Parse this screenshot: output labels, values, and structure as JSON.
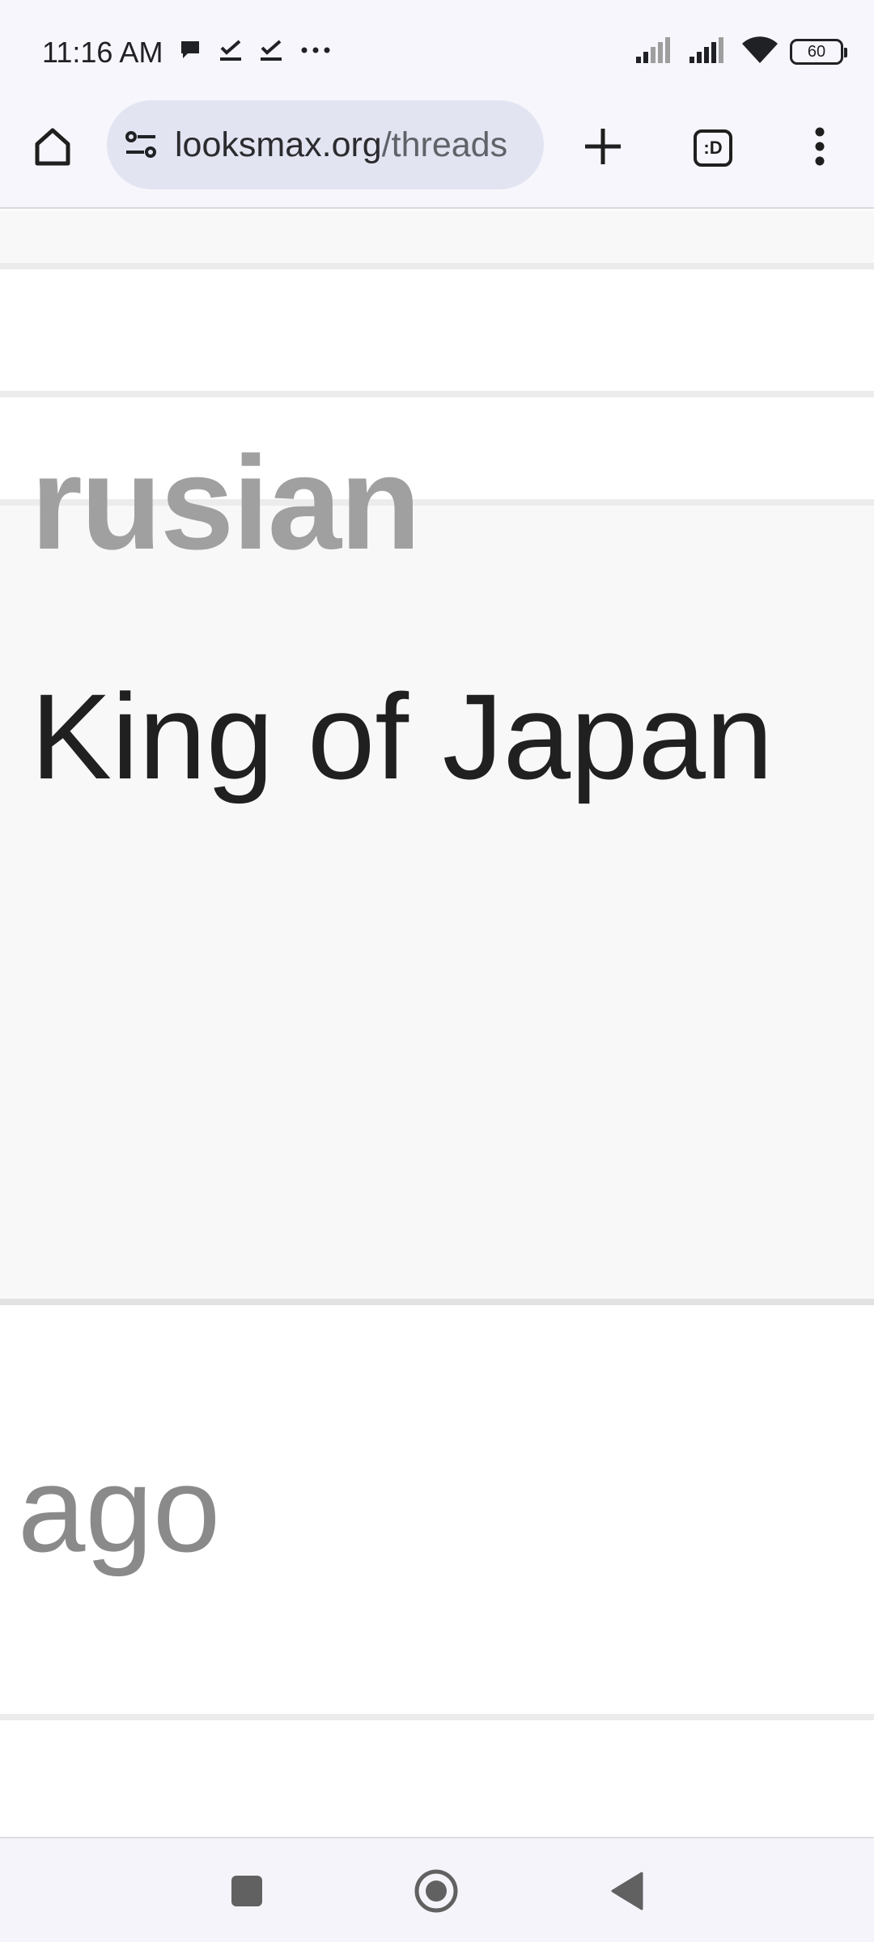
{
  "status_bar": {
    "time": "11:16 AM",
    "left_icons": [
      "chat-bubble-icon",
      "download-done-icon",
      "download-done-icon",
      "more-dots-icon"
    ],
    "right_icons": [
      "signal-icon",
      "signal-icon",
      "wifi-icon"
    ],
    "battery_level": "60"
  },
  "toolbar": {
    "url_domain": "looksmax.org",
    "url_path": "/threads",
    "tab_count": ":D",
    "icons": {
      "home": "home-icon",
      "site_info": "tune-icon",
      "new_tab": "plus-icon",
      "menu": "more-vert-icon"
    }
  },
  "post": {
    "username": "rusian",
    "user_title": "King of Japan",
    "time_ago": "ago"
  },
  "colors": {
    "chrome_bg": "#f7f6fc",
    "url_pill": "#e2e4f1",
    "post_band": "#f8f8f8",
    "username": "#a0a0a0",
    "title": "#202020",
    "time": "#8a8a8a"
  },
  "navbar": {
    "icons": [
      "recents-square-icon",
      "home-circle-icon",
      "back-triangle-icon"
    ]
  }
}
